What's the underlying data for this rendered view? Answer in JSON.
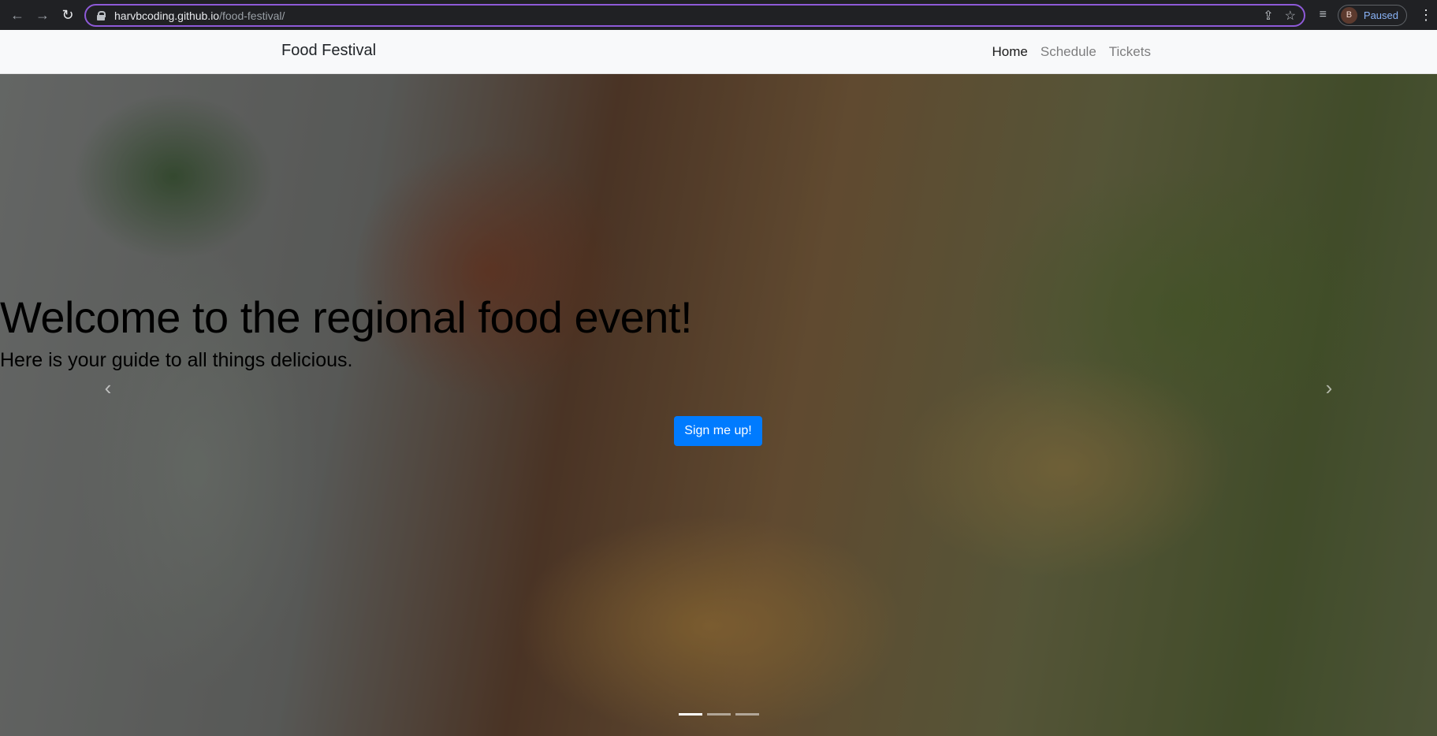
{
  "browser": {
    "back_icon": "arrow-left-icon",
    "forward_icon": "arrow-right-icon",
    "reload_icon": "reload-icon",
    "url_host": "harvbcoding.github.io",
    "url_path": "/food-festival/",
    "profile_initial": "B",
    "profile_status": "Paused",
    "accent_color": "#8e5ad8"
  },
  "navbar": {
    "brand": "Food Festival",
    "links": [
      {
        "label": "Home",
        "active": true
      },
      {
        "label": "Schedule",
        "active": false
      },
      {
        "label": "Tickets",
        "active": false
      }
    ]
  },
  "hero": {
    "title": "Welcome to the regional food event!",
    "subtitle": "Here is your guide to all things delicious.",
    "cta_label": "Sign me up!",
    "cta_color": "#007bff",
    "prev_icon": "‹",
    "next_icon": "›",
    "slides": 3,
    "active_slide": 1
  }
}
